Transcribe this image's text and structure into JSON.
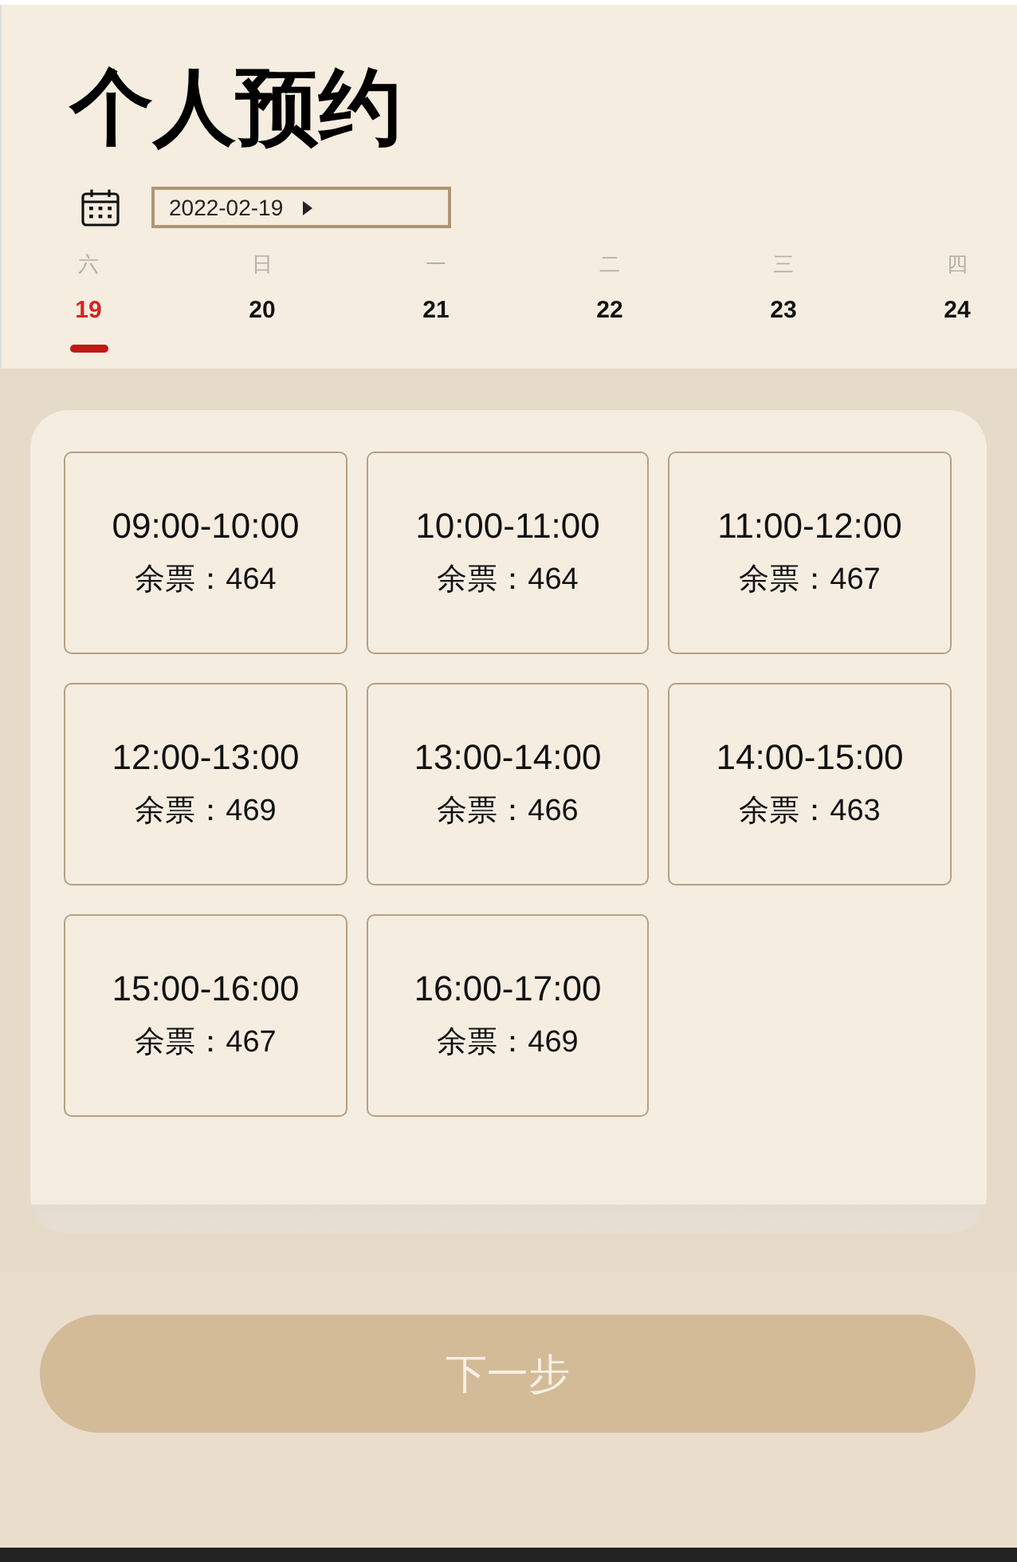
{
  "header": {
    "title": "个人预约",
    "date_picker": {
      "value": "2022-02-19"
    }
  },
  "days": [
    {
      "weekday": "六",
      "day": "19",
      "selected": true
    },
    {
      "weekday": "日",
      "day": "20",
      "selected": false
    },
    {
      "weekday": "一",
      "day": "21",
      "selected": false
    },
    {
      "weekday": "二",
      "day": "22",
      "selected": false
    },
    {
      "weekday": "三",
      "day": "23",
      "selected": false
    },
    {
      "weekday": "四",
      "day": "24",
      "selected": false
    }
  ],
  "slots": [
    {
      "time": "09:00-10:00",
      "tickets": "余票：464"
    },
    {
      "time": "10:00-11:00",
      "tickets": "余票：464"
    },
    {
      "time": "11:00-12:00",
      "tickets": "余票：467"
    },
    {
      "time": "12:00-13:00",
      "tickets": "余票：469"
    },
    {
      "time": "13:00-14:00",
      "tickets": "余票：466"
    },
    {
      "time": "14:00-15:00",
      "tickets": "余票：463"
    },
    {
      "time": "15:00-16:00",
      "tickets": "余票：467"
    },
    {
      "time": "16:00-17:00",
      "tickets": "余票：469"
    }
  ],
  "next_button": {
    "label": "下一步"
  }
}
